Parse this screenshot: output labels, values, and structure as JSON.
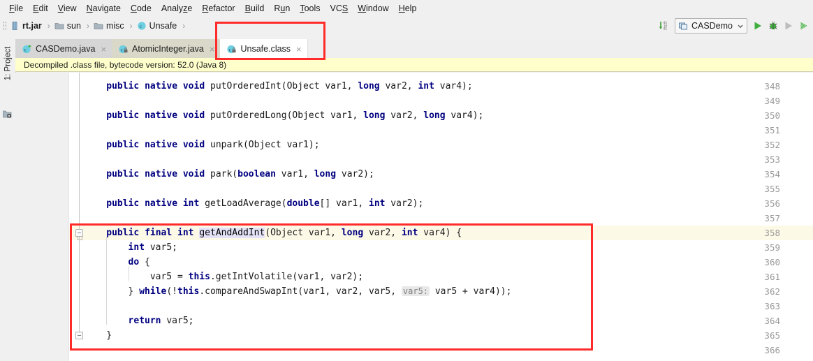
{
  "menu": {
    "items": [
      {
        "label": "File",
        "mn": "F"
      },
      {
        "label": "Edit",
        "mn": "E"
      },
      {
        "label": "View",
        "mn": "V"
      },
      {
        "label": "Navigate",
        "mn": "N"
      },
      {
        "label": "Code",
        "mn": "C"
      },
      {
        "label": "Analyze",
        "mn": "z"
      },
      {
        "label": "Refactor",
        "mn": "R"
      },
      {
        "label": "Build",
        "mn": "B"
      },
      {
        "label": "Run",
        "mn": "u"
      },
      {
        "label": "Tools",
        "mn": "T"
      },
      {
        "label": "VCS",
        "mn": "S"
      },
      {
        "label": "Window",
        "mn": "W"
      },
      {
        "label": "Help",
        "mn": "H"
      }
    ]
  },
  "breadcrumb": {
    "items": [
      {
        "label": "rt.jar",
        "icon": "jar-icon",
        "bold": true
      },
      {
        "label": "sun",
        "icon": "folder-icon",
        "bold": false
      },
      {
        "label": "misc",
        "icon": "folder-icon",
        "bold": false
      },
      {
        "label": "Unsafe",
        "icon": "class-icon",
        "bold": false
      }
    ],
    "separator": "›"
  },
  "toolbar": {
    "sort_icon": "sort-binary-icon",
    "run_config": {
      "name": "CASDemo",
      "icon": "application-icon",
      "chevron": "chevron-down-icon"
    },
    "buttons": [
      {
        "name": "run-button",
        "icon": "run-triangle-icon",
        "enabled": true
      },
      {
        "name": "debug-button",
        "icon": "debug-bug-icon",
        "enabled": true
      },
      {
        "name": "run-with-coverage-button",
        "icon": "run-triangle-icon",
        "enabled": false
      },
      {
        "name": "profile-button",
        "icon": "profile-icon",
        "enabled": true
      }
    ]
  },
  "toolwindow": {
    "project_label": "1: Project",
    "structure_icon": "structure-icon"
  },
  "tabs": [
    {
      "label": "CASDemo.java",
      "icon": "java-class-runnable-icon",
      "state": "inactive",
      "close": "×"
    },
    {
      "label": "AtomicInteger.java",
      "icon": "java-class-locked-icon",
      "state": "inactive-alt",
      "close": "×"
    },
    {
      "label": "Unsafe.class",
      "icon": "class-file-locked-icon",
      "state": "active",
      "close": "×"
    }
  ],
  "banner": {
    "text": "Decompiled .class file, bytecode version: 52.0 (Java 8)"
  },
  "editor": {
    "first_line": 348,
    "lines": [
      {
        "n": 348,
        "indent": 1,
        "tokens": [
          {
            "t": "public",
            "c": "kw"
          },
          {
            "t": " ",
            "c": "pl"
          },
          {
            "t": "native",
            "c": "kw"
          },
          {
            "t": " ",
            "c": "pl"
          },
          {
            "t": "void",
            "c": "kw"
          },
          {
            "t": " putOrderedInt(Object var1, ",
            "c": "pl"
          },
          {
            "t": "long",
            "c": "kw"
          },
          {
            "t": " var2, ",
            "c": "pl"
          },
          {
            "t": "int",
            "c": "kw"
          },
          {
            "t": " var4);",
            "c": "pl"
          }
        ]
      },
      {
        "n": 349,
        "indent": 0,
        "tokens": []
      },
      {
        "n": 350,
        "indent": 1,
        "tokens": [
          {
            "t": "public",
            "c": "kw"
          },
          {
            "t": " ",
            "c": "pl"
          },
          {
            "t": "native",
            "c": "kw"
          },
          {
            "t": " ",
            "c": "pl"
          },
          {
            "t": "void",
            "c": "kw"
          },
          {
            "t": " putOrderedLong(Object var1, ",
            "c": "pl"
          },
          {
            "t": "long",
            "c": "kw"
          },
          {
            "t": " var2, ",
            "c": "pl"
          },
          {
            "t": "long",
            "c": "kw"
          },
          {
            "t": " var4);",
            "c": "pl"
          }
        ]
      },
      {
        "n": 351,
        "indent": 0,
        "tokens": []
      },
      {
        "n": 352,
        "indent": 1,
        "tokens": [
          {
            "t": "public",
            "c": "kw"
          },
          {
            "t": " ",
            "c": "pl"
          },
          {
            "t": "native",
            "c": "kw"
          },
          {
            "t": " ",
            "c": "pl"
          },
          {
            "t": "void",
            "c": "kw"
          },
          {
            "t": " unpark(Object var1);",
            "c": "pl"
          }
        ]
      },
      {
        "n": 353,
        "indent": 0,
        "tokens": []
      },
      {
        "n": 354,
        "indent": 1,
        "tokens": [
          {
            "t": "public",
            "c": "kw"
          },
          {
            "t": " ",
            "c": "pl"
          },
          {
            "t": "native",
            "c": "kw"
          },
          {
            "t": " ",
            "c": "pl"
          },
          {
            "t": "void",
            "c": "kw"
          },
          {
            "t": " park(",
            "c": "pl"
          },
          {
            "t": "boolean",
            "c": "kw"
          },
          {
            "t": " var1, ",
            "c": "pl"
          },
          {
            "t": "long",
            "c": "kw"
          },
          {
            "t": " var2);",
            "c": "pl"
          }
        ]
      },
      {
        "n": 355,
        "indent": 0,
        "tokens": []
      },
      {
        "n": 356,
        "indent": 1,
        "tokens": [
          {
            "t": "public",
            "c": "kw"
          },
          {
            "t": " ",
            "c": "pl"
          },
          {
            "t": "native",
            "c": "kw"
          },
          {
            "t": " ",
            "c": "pl"
          },
          {
            "t": "int",
            "c": "kw"
          },
          {
            "t": " getLoadAverage(",
            "c": "pl"
          },
          {
            "t": "double",
            "c": "kw"
          },
          {
            "t": "[] var1, ",
            "c": "pl"
          },
          {
            "t": "int",
            "c": "kw"
          },
          {
            "t": " var2);",
            "c": "pl"
          }
        ]
      },
      {
        "n": 357,
        "indent": 0,
        "tokens": []
      },
      {
        "n": 358,
        "indent": 1,
        "caret": true,
        "fold": "top",
        "tokens": [
          {
            "t": "public",
            "c": "kw"
          },
          {
            "t": " ",
            "c": "pl"
          },
          {
            "t": "final",
            "c": "kw"
          },
          {
            "t": " ",
            "c": "pl"
          },
          {
            "t": "int",
            "c": "kw"
          },
          {
            "t": " ",
            "c": "pl"
          },
          {
            "t": "getAndAddInt",
            "c": "hl-id"
          },
          {
            "t": "(Object var1, ",
            "c": "pl"
          },
          {
            "t": "long",
            "c": "kw"
          },
          {
            "t": " var2, ",
            "c": "pl"
          },
          {
            "t": "int",
            "c": "kw"
          },
          {
            "t": " var4) {",
            "c": "pl"
          }
        ]
      },
      {
        "n": 359,
        "indent": 2,
        "tokens": [
          {
            "t": "int",
            "c": "kw"
          },
          {
            "t": " var5;",
            "c": "pl"
          }
        ]
      },
      {
        "n": 360,
        "indent": 2,
        "tokens": [
          {
            "t": "do",
            "c": "kw"
          },
          {
            "t": " {",
            "c": "pl"
          }
        ]
      },
      {
        "n": 361,
        "indent": 3,
        "tokens": [
          {
            "t": "var5 = ",
            "c": "pl"
          },
          {
            "t": "this",
            "c": "kw"
          },
          {
            "t": ".getIntVolatile(var1, var2);",
            "c": "pl"
          }
        ]
      },
      {
        "n": 362,
        "indent": 2,
        "tokens": [
          {
            "t": "} ",
            "c": "pl"
          },
          {
            "t": "while",
            "c": "kw"
          },
          {
            "t": "(!",
            "c": "pl"
          },
          {
            "t": "this",
            "c": "kw"
          },
          {
            "t": ".compareAndSwapInt(var1, var2, var5, ",
            "c": "pl"
          },
          {
            "t": "var5:",
            "c": "phint"
          },
          {
            "t": " var5 + var4));",
            "c": "pl"
          }
        ]
      },
      {
        "n": 363,
        "indent": 0,
        "tokens": []
      },
      {
        "n": 364,
        "indent": 2,
        "tokens": [
          {
            "t": "return",
            "c": "kw"
          },
          {
            "t": " var5;",
            "c": "pl"
          }
        ]
      },
      {
        "n": 365,
        "indent": 1,
        "fold": "bottom",
        "tokens": [
          {
            "t": "}",
            "c": "pl"
          }
        ]
      },
      {
        "n": 366,
        "indent": 0,
        "tokens": []
      }
    ]
  },
  "annotations": {
    "tab_highlight": {
      "name": "red-box-around-unsafe-tab",
      "color": "#ff2b2b"
    },
    "code_highlight": {
      "name": "red-box-around-getandaddint-method",
      "color": "#ff2b2b"
    }
  },
  "colors": {
    "keyword": "#000080",
    "accent_red": "#ff2b2b",
    "banner_bg": "#ffffcc",
    "caret_line": "#fdf9e7",
    "identifier_highlight": "#e4e2f7"
  }
}
